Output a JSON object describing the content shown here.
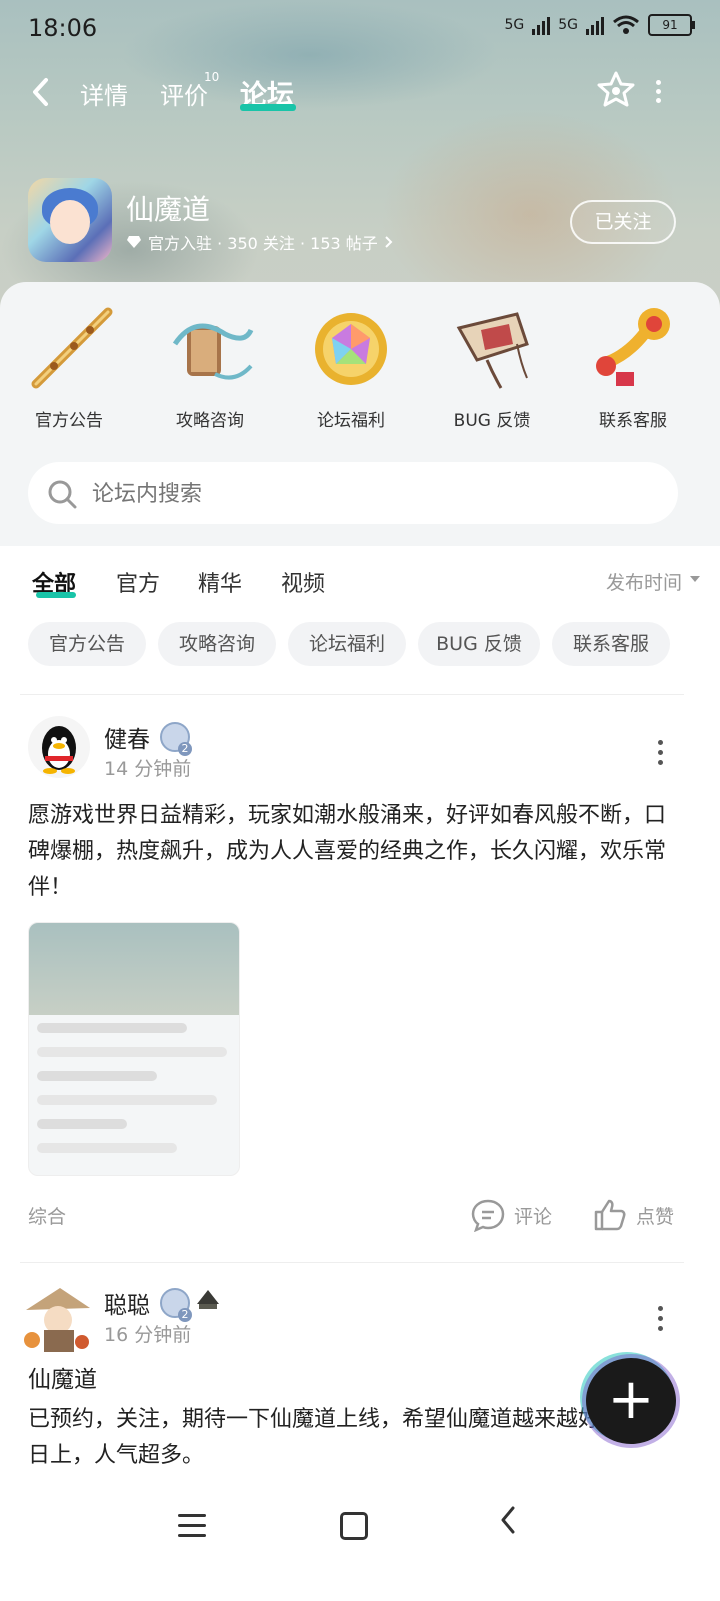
{
  "status_bar": {
    "time": "18:06",
    "network1": "5G",
    "network2": "5G",
    "battery": "91"
  },
  "nav": {
    "tabs": [
      {
        "label": "详情"
      },
      {
        "label": "评价",
        "badge": "10"
      },
      {
        "label": "论坛"
      }
    ],
    "active_tab": "论坛"
  },
  "game": {
    "title": "仙魔道",
    "meta": "官方入驻 · 350 关注 · 153 帖子",
    "follow_label": "已关注"
  },
  "categories": [
    {
      "label": "官方公告",
      "icon": "flute-icon"
    },
    {
      "label": "攻略咨询",
      "icon": "scroll-icon"
    },
    {
      "label": "论坛福利",
      "icon": "gem-icon"
    },
    {
      "label": "BUG 反馈",
      "icon": "kite-icon"
    },
    {
      "label": "联系客服",
      "icon": "ruyi-icon"
    }
  ],
  "search": {
    "placeholder": "论坛内搜索"
  },
  "filter_tabs": [
    "全部",
    "官方",
    "精华",
    "视频"
  ],
  "sort_label": "发布时间",
  "chips": [
    "官方公告",
    "攻略咨询",
    "论坛福利",
    "BUG 反馈",
    "联系客服"
  ],
  "posts": [
    {
      "author": "健春",
      "level": "2",
      "time": "14 分钟前",
      "content": "愿游戏世界日益精彩，玩家如潮水般涌来，好评如春风般不断，口碑爆棚，热度飙升，成为人人喜爱的经典之作，长久闪耀，欢乐常伴！",
      "tag": "综合",
      "comment_label": "评论",
      "like_label": "点赞"
    },
    {
      "author": "聪聪",
      "level": "2",
      "time": "16 分钟前",
      "title": "仙魔道",
      "content": "已预约，关注，期待一下仙魔道上线，希望仙魔道越来越好，蒸蒸日上，人气超多。"
    }
  ],
  "colors": {
    "accent": "#19c4a8",
    "banner": "#b8c9c2"
  }
}
